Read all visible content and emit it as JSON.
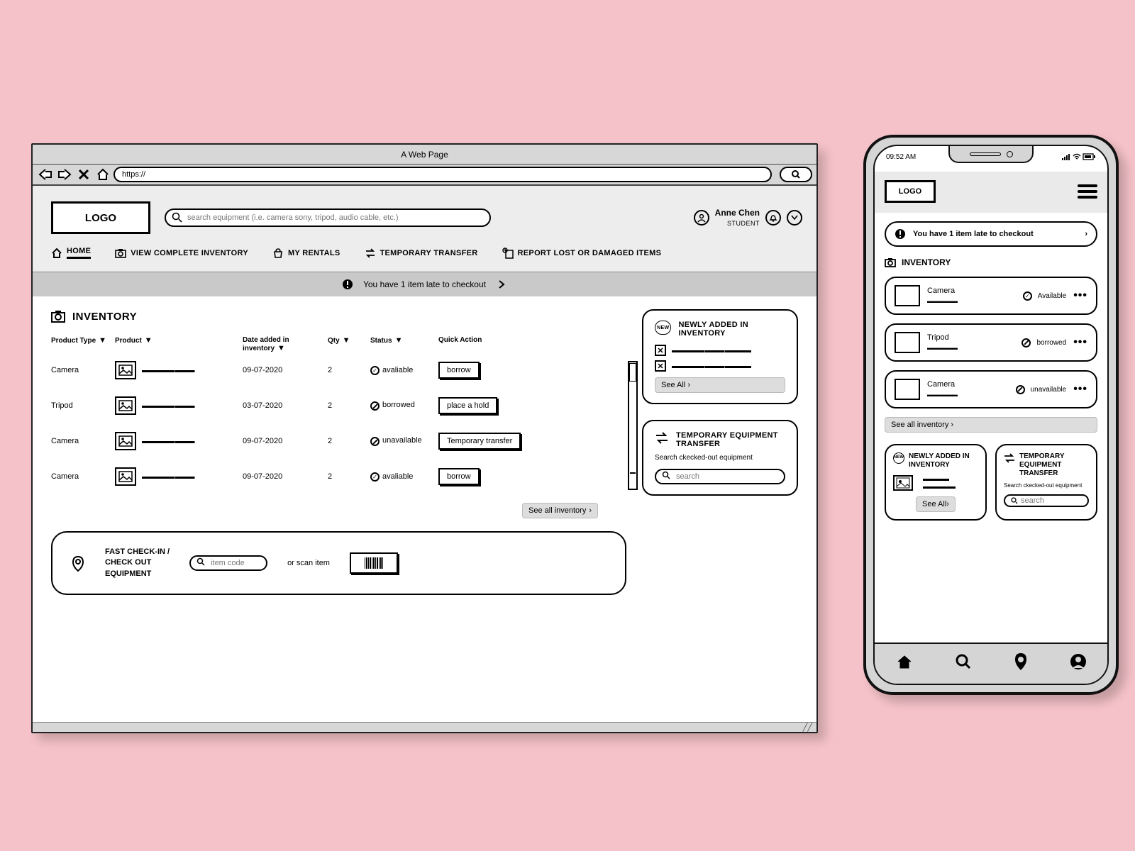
{
  "browser": {
    "title": "A Web Page",
    "url": "https://"
  },
  "header": {
    "logo": "LOGO",
    "search_placeholder": "search equipment (i.e. camera sony, tripod, audio cable, etc.)",
    "user_name": "Anne Chen",
    "user_role": "STUDENT"
  },
  "nav": {
    "home": "HOME",
    "view_inventory": "VIEW COMPLETE INVENTORY",
    "my_rentals": "MY RENTALS",
    "temp_transfer": "TEMPORARY TRANSFER",
    "report": "REPORT LOST OR DAMAGED ITEMS"
  },
  "alert": {
    "text": "You have 1 item late to checkout"
  },
  "inventory": {
    "title": "INVENTORY",
    "columns": {
      "type": "Product Type",
      "product": "Product",
      "date": "Date added in inventory",
      "qty": "Qty",
      "status": "Status",
      "action": "Quick Action"
    },
    "rows": [
      {
        "type": "Camera",
        "date": "09-07-2020",
        "qty": "2",
        "status": "avaliable",
        "status_kind": "ok",
        "action": "borrow"
      },
      {
        "type": "Tripod",
        "date": "03-07-2020",
        "qty": "2",
        "status": "borrowed",
        "status_kind": "dash",
        "action": "place a hold"
      },
      {
        "type": "Camera",
        "date": "09-07-2020",
        "qty": "2",
        "status": "unavailable",
        "status_kind": "dash",
        "action": "Temporary transfer"
      },
      {
        "type": "Camera",
        "date": "09-07-2020",
        "qty": "2",
        "status": "avaliable",
        "status_kind": "ok",
        "action": "borrow"
      }
    ],
    "see_all": "See all inventory"
  },
  "newly_added": {
    "badge": "NEW",
    "title": "NEWLY ADDED IN INVENTORY",
    "see_all": "See All"
  },
  "temp_card": {
    "title": "TEMPORARY EQUIPMENT TRANSFER",
    "sub": "Search ckecked-out equipment",
    "search_placeholder": "search"
  },
  "fast": {
    "title_l1": "FAST CHECK-IN /",
    "title_l2": "CHECK OUT",
    "title_l3": "EQUIPMENT",
    "item_code_placeholder": "item code",
    "or_scan": "or scan item"
  },
  "mobile": {
    "time": "09:52 AM",
    "logo": "LOGO",
    "alert": "You have 1 item late to checkout",
    "inventory_title": "INVENTORY",
    "items": [
      {
        "name": "Camera",
        "status": "Available",
        "status_kind": "ok"
      },
      {
        "name": "Tripod",
        "status": "borrowed",
        "status_kind": "dash"
      },
      {
        "name": "Camera",
        "status": "unavailable",
        "status_kind": "dash"
      }
    ],
    "see_all": "See all inventory",
    "new_card_title": "NEWLY ADDED IN  INVENTORY",
    "new_card_badge": "NEW",
    "new_card_see_all": "See All",
    "temp_title": "TEMPORARY EQUIPMENT TRANSFER",
    "temp_sub": "Search ckecked-out equipment",
    "temp_search_placeholder": "search"
  }
}
